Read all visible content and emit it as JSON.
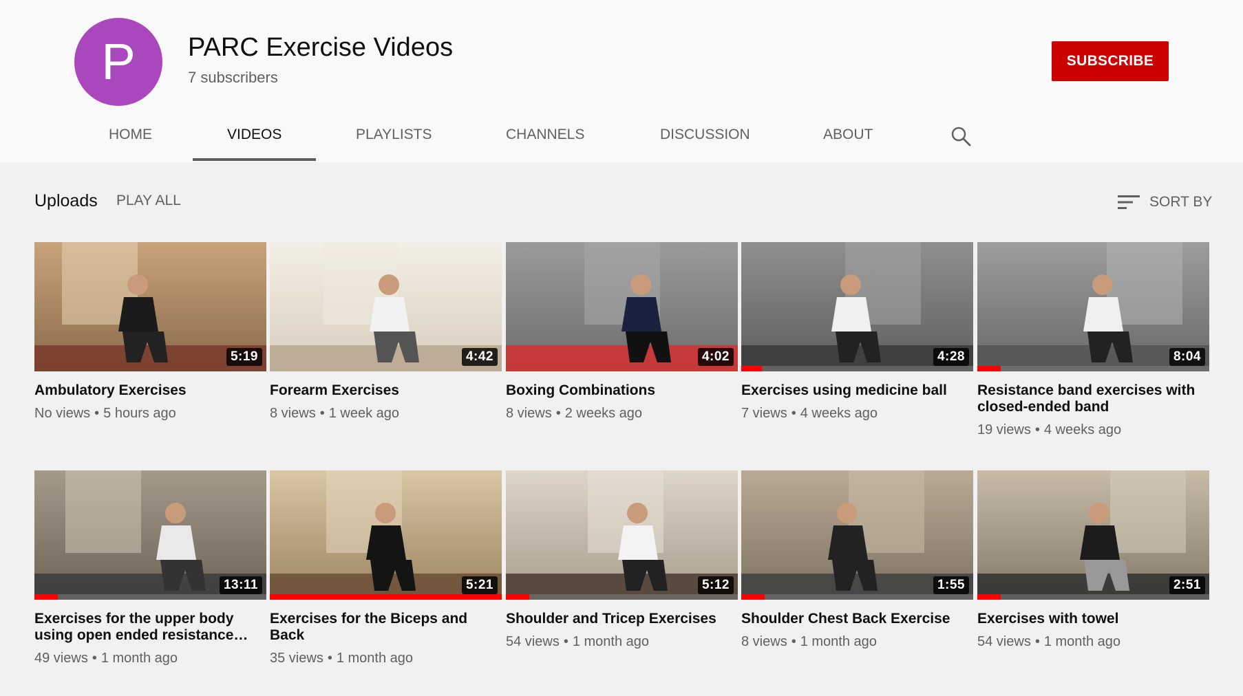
{
  "channel": {
    "avatar_letter": "P",
    "name": "PARC Exercise Videos",
    "subscribers": "7 subscribers",
    "subscribe_label": "SUBSCRIBE"
  },
  "tabs": [
    {
      "label": "HOME"
    },
    {
      "label": "VIDEOS"
    },
    {
      "label": "PLAYLISTS"
    },
    {
      "label": "CHANNELS"
    },
    {
      "label": "DISCUSSION"
    },
    {
      "label": "ABOUT"
    }
  ],
  "active_tab": "VIDEOS",
  "section": {
    "title": "Uploads",
    "play_all": "PLAY ALL",
    "sort_by": "SORT BY"
  },
  "colors": {
    "subscribe": "#cc0000",
    "progress": "#ff0000",
    "avatar": "#ab47bc"
  },
  "videos": [
    {
      "title": "Ambulatory Exercises",
      "views": "No views",
      "age": "5 hours ago",
      "duration": "5:19",
      "watched": 0
    },
    {
      "title": "Forearm Exercises",
      "views": "8 views",
      "age": "1 week ago",
      "duration": "4:42",
      "watched": 0
    },
    {
      "title": "Boxing Combinations",
      "views": "8 views",
      "age": "2 weeks ago",
      "duration": "4:02",
      "watched": 0
    },
    {
      "title": "Exercises using medicine ball",
      "views": "7 views",
      "age": "4 weeks ago",
      "duration": "4:28",
      "watched": 0.09
    },
    {
      "title": "Resistance band exercises with closed-ended band",
      "views": "19 views",
      "age": "4 weeks ago",
      "duration": "8:04",
      "watched": 0.1
    },
    {
      "title": "Exercises for the upper body using open ended resistance band",
      "views": "49 views",
      "age": "1 month ago",
      "duration": "13:11",
      "watched": 0.1
    },
    {
      "title": "Exercises for the Biceps and Back",
      "views": "35 views",
      "age": "1 month ago",
      "duration": "5:21",
      "watched": 1.0
    },
    {
      "title": "Shoulder and Tricep Exercises",
      "views": "54 views",
      "age": "1 month ago",
      "duration": "5:12",
      "watched": 0.1
    },
    {
      "title": "Shoulder Chest Back Exercise",
      "views": "8 views",
      "age": "1 month ago",
      "duration": "1:55",
      "watched": 0.1
    },
    {
      "title": "Exercises with towel",
      "views": "54 views",
      "age": "1 month ago",
      "duration": "2:51",
      "watched": 0.1
    }
  ]
}
